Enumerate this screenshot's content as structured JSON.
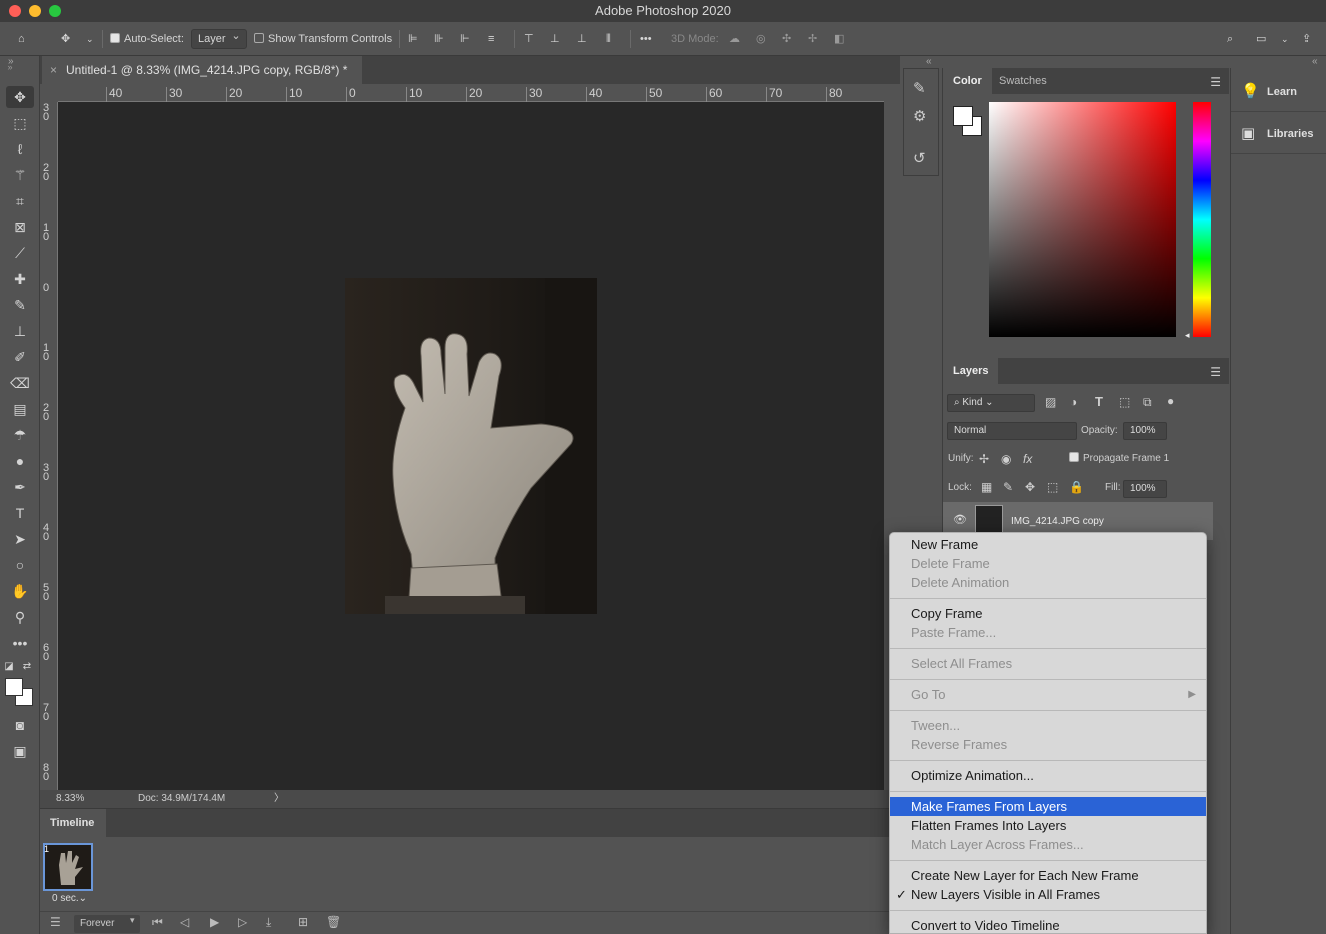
{
  "app": {
    "title": "Adobe Photoshop 2020"
  },
  "options_bar": {
    "auto_select_label": "Auto-Select:",
    "auto_select_value": "Layer",
    "show_transform_label": "Show Transform Controls",
    "mode_3d_label": "3D Mode:"
  },
  "document": {
    "tab_title": "Untitled-1 @ 8.33% (IMG_4214.JPG copy, RGB/8*) *",
    "zoom": "8.33%",
    "doc_size": "Doc: 34.9M/174.4M"
  },
  "ruler": {
    "h_ticks": [
      "40",
      "30",
      "20",
      "10",
      "0",
      "10",
      "20",
      "30",
      "40",
      "50",
      "60",
      "70",
      "80"
    ],
    "v_ticks": [
      "30",
      "20",
      "10",
      "0",
      "10",
      "20",
      "30",
      "40",
      "50",
      "60",
      "70",
      "80"
    ]
  },
  "timeline": {
    "tab_label": "Timeline",
    "frame_number": "1",
    "frame_delay": "0 sec.⌄",
    "loop_value": "Forever"
  },
  "color_panel": {
    "tabs": [
      "Color",
      "Swatches"
    ],
    "fg_color": "#ffffff",
    "bg_color": "#ffffff"
  },
  "layers_panel": {
    "tab_label": "Layers",
    "filter_kind": "Kind",
    "blend_mode": "Normal",
    "opacity_label": "Opacity:",
    "opacity_value": "100%",
    "unify_label": "Unify:",
    "propagate_label": "Propagate Frame 1",
    "lock_label": "Lock:",
    "fill_label": "Fill:",
    "fill_value": "100%",
    "layer_name": "IMG_4214.JPG copy"
  },
  "far_panel": {
    "learn_label": "Learn",
    "libraries_label": "Libraries"
  },
  "context_menu": {
    "items": [
      {
        "label": "New Frame",
        "disabled": false
      },
      {
        "label": "Delete Frame",
        "disabled": true
      },
      {
        "label": "Delete Animation",
        "disabled": true
      },
      {
        "label": "Copy Frame",
        "disabled": false
      },
      {
        "label": "Paste Frame...",
        "disabled": true
      },
      {
        "label": "Select All Frames",
        "disabled": true
      },
      {
        "label": "Go To",
        "disabled": true
      },
      {
        "label": "Tween...",
        "disabled": true
      },
      {
        "label": "Reverse Frames",
        "disabled": true
      },
      {
        "label": "Optimize Animation...",
        "disabled": false
      },
      {
        "label": "Make Frames From Layers",
        "disabled": false,
        "highlighted": true
      },
      {
        "label": "Flatten Frames Into Layers",
        "disabled": false
      },
      {
        "label": "Match Layer Across Frames...",
        "disabled": true
      },
      {
        "label": "Create New Layer for Each New Frame",
        "disabled": false
      },
      {
        "label": "New Layers Visible in All Frames",
        "disabled": false,
        "checked": true
      },
      {
        "label": "Convert to Video Timeline",
        "disabled": false
      }
    ],
    "highlight_color": "#2a63d6"
  }
}
